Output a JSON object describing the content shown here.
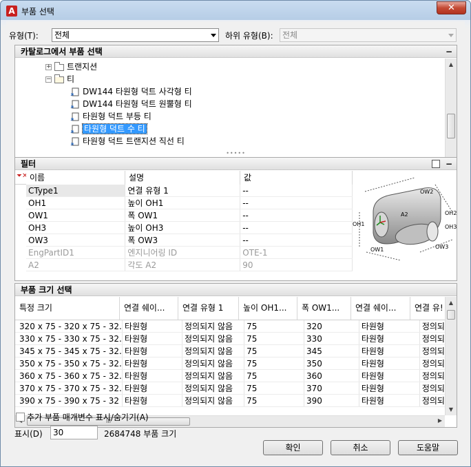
{
  "window": {
    "title": "부품 선택",
    "app_icon": "A",
    "close": "✕"
  },
  "type_row": {
    "type_label": "유형(T):",
    "type_value": "전체",
    "subtype_label": "하위 유형(B):",
    "subtype_value": "전체"
  },
  "catalog": {
    "header": "카탈로그에서 부품 선택",
    "collapse": "−",
    "items": [
      {
        "label": "트랜지션",
        "kind": "folder-collapsed"
      },
      {
        "label": "티",
        "kind": "folder-open"
      },
      {
        "label": "DW144 타원형 덕트 사각형 티",
        "kind": "part"
      },
      {
        "label": "DW144 타원형 덕트 원뿔형 티",
        "kind": "part"
      },
      {
        "label": "타원형 덕트 부등 티",
        "kind": "part"
      },
      {
        "label": "타원형 덕트 수 티",
        "kind": "part",
        "selected": true
      },
      {
        "label": "타원형 덕트 트랜지션 직선 티",
        "kind": "part"
      }
    ]
  },
  "filter": {
    "header": "필터",
    "collapse": "−",
    "columns": [
      "이름",
      "설명",
      "값"
    ],
    "rows": [
      {
        "name": "CType1",
        "desc": "연결 유형 1",
        "value": "--",
        "disabled": false
      },
      {
        "name": "OH1",
        "desc": "높이 OH1",
        "value": "--",
        "disabled": false
      },
      {
        "name": "OW1",
        "desc": "폭 OW1",
        "value": "--",
        "disabled": false
      },
      {
        "name": "OH3",
        "desc": "높이 OH3",
        "value": "--",
        "disabled": false
      },
      {
        "name": "OW3",
        "desc": "폭 OW3",
        "value": "--",
        "disabled": false
      },
      {
        "name": "EngPartID1",
        "desc": "엔지니어링 ID",
        "value": "OTE-1",
        "disabled": true
      },
      {
        "name": "A2",
        "desc": "각도 A2",
        "value": "90",
        "disabled": true
      }
    ],
    "preview_labels": [
      "OW2",
      "OH2",
      "A2",
      "OH1",
      "OW1",
      "OW3",
      "OH3"
    ]
  },
  "sizes": {
    "header": "부품 크기 선택",
    "columns": [
      "특정 크기",
      "연결 쉐이...",
      "연결 유형 1",
      "높이 OH1...",
      "폭 OW1...",
      "연결 쉐이...",
      "연결 유!"
    ],
    "rows": [
      [
        "320 x 75 - 320 x 75 - 32...",
        "타원형",
        "정의되지 않음",
        "75",
        "320",
        "타원형",
        "정의되지"
      ],
      [
        "330 x 75 - 330 x 75 - 32...",
        "타원형",
        "정의되지 않음",
        "75",
        "330",
        "타원형",
        "정의되지"
      ],
      [
        "345 x 75 - 345 x 75 - 32...",
        "타원형",
        "정의되지 않음",
        "75",
        "345",
        "타원형",
        "정의되지"
      ],
      [
        "350 x 75 - 350 x 75 - 32...",
        "타원형",
        "정의되지 않음",
        "75",
        "350",
        "타원형",
        "정의되지"
      ],
      [
        "360 x 75 - 360 x 75 - 32...",
        "타원형",
        "정의되지 않음",
        "75",
        "360",
        "타원형",
        "정의되지"
      ],
      [
        "370 x 75 - 370 x 75 - 32...",
        "타원형",
        "정의되지 않음",
        "75",
        "370",
        "타원형",
        "정의되지"
      ],
      [
        "390 x 75 - 390 x 75 - 32",
        "타원형",
        "정의되지 않음",
        "75",
        "390",
        "타원형",
        "정의되지"
      ]
    ],
    "hscroll_grip": "III"
  },
  "footer": {
    "show_params_label": "추가 부품 매개변수 표시/숨기기(A)",
    "display_label": "표시(D)",
    "display_value": "30",
    "count_text": "2684748 부품 크기",
    "ok": "확인",
    "cancel": "취소",
    "help": "도움말"
  }
}
